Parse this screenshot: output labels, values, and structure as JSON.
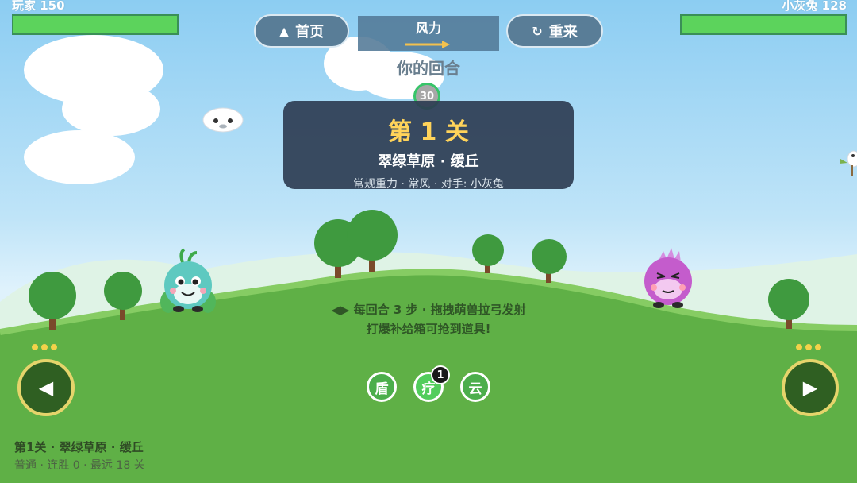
{
  "players": {
    "left": {
      "label": "玩家 150",
      "hp": 1.0,
      "color": "#5cd35c"
    },
    "right": {
      "label": "小灰兔 128",
      "hp": 1.0,
      "color": "#5cd35c"
    }
  },
  "top_bar": {
    "home_label": "首页",
    "home_icon": "home-icon",
    "restart_label": "重来",
    "restart_icon": "refresh-icon",
    "wind_label": "风力",
    "wind_direction": "right",
    "wind_color": "#f2c14e"
  },
  "turn": {
    "text": "你的回合",
    "timer": "30"
  },
  "level_banner": {
    "title": "第 1 关",
    "subtitle": "翠绿草原 · 缓丘",
    "info": "常规重力 · 常风 · 对手: 小灰兔"
  },
  "hint": {
    "line1": "◀▶ 每回合 3 步 · 拖拽萌兽拉弓发射",
    "line2": "打爆补给箱可抢到道具!"
  },
  "items": [
    {
      "label": "盾"
    },
    {
      "label": "疗",
      "count": "1"
    },
    {
      "label": "云"
    }
  ],
  "controls": {
    "left_icon": "◀",
    "right_icon": "▶",
    "steps_remaining": 3
  },
  "footer": {
    "level": "第1关 · 翠绿草原 · 缓丘",
    "stats": "普通 · 连胜 0 · 最远 18 关"
  },
  "colors": {
    "sky": "#8ccdf2",
    "grass": "#5fb046",
    "banner_bg": "#2e3d52",
    "title_gold": "#ffd35a",
    "player_monster": "#5ec9c0",
    "enemy_monster": "#c45ccc"
  }
}
